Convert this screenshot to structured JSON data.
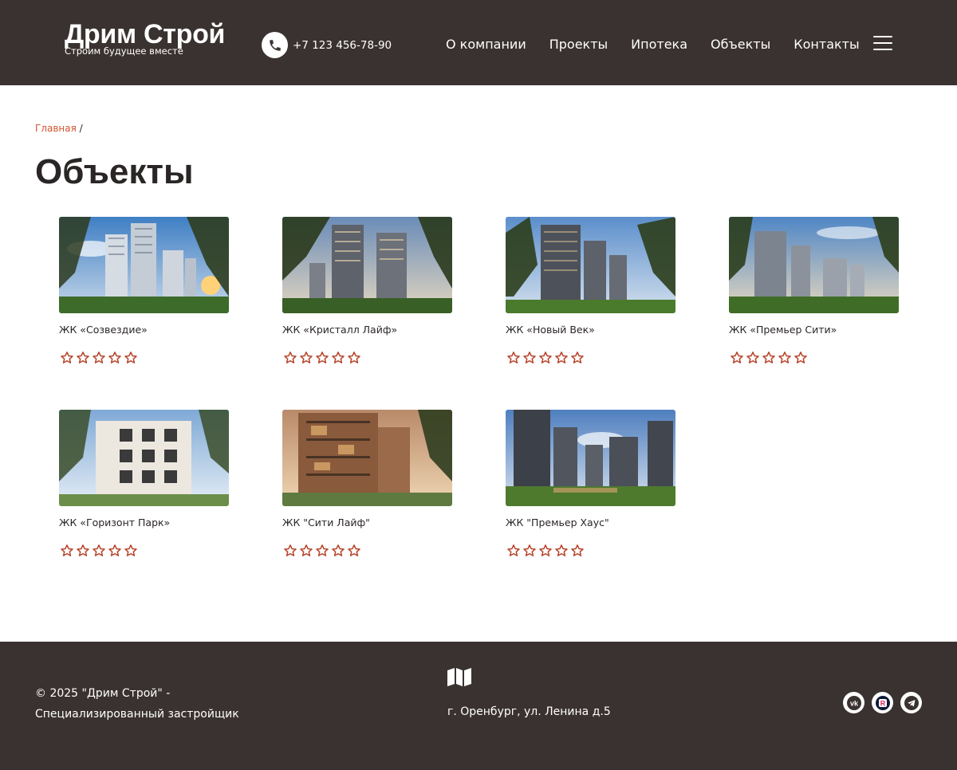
{
  "header": {
    "logo_title": "Дрим Строй",
    "logo_subtitle": "Строим будущее вместе",
    "phone": "+7 123 456-78-90",
    "nav": [
      "О компании",
      "Проекты",
      "Ипотека",
      "Объекты",
      "Контакты"
    ]
  },
  "breadcrumb": {
    "home": "Главная",
    "separator": "/"
  },
  "page_title": "Объекты",
  "objects": [
    {
      "name": "ЖК «Созвездие»",
      "rating": 0,
      "max_rating": 5
    },
    {
      "name": "ЖК «Кристалл Лайф»",
      "rating": 0,
      "max_rating": 5
    },
    {
      "name": "ЖК «Новый Век»",
      "rating": 0,
      "max_rating": 5
    },
    {
      "name": "ЖК «Премьер Сити»",
      "rating": 0,
      "max_rating": 5
    },
    {
      "name": "ЖК «Горизонт Парк»",
      "rating": 0,
      "max_rating": 5
    },
    {
      "name": "ЖК \"Сити Лайф\"",
      "rating": 0,
      "max_rating": 5
    },
    {
      "name": "ЖК \"Премьер Хаус\"",
      "rating": 0,
      "max_rating": 5
    }
  ],
  "footer": {
    "copyright_line1": "© 2025 \"Дрим Строй\" -",
    "copyright_line2": "Специализированный застройщик",
    "address": "г. Оренбург, ул. Ленина д.5",
    "socials": [
      "vk-icon",
      "rutube-icon",
      "telegram-icon"
    ]
  },
  "colors": {
    "header_bg": "#3a3230",
    "accent": "#d4552e",
    "star": "#b8432a",
    "text": "#2b2626"
  }
}
